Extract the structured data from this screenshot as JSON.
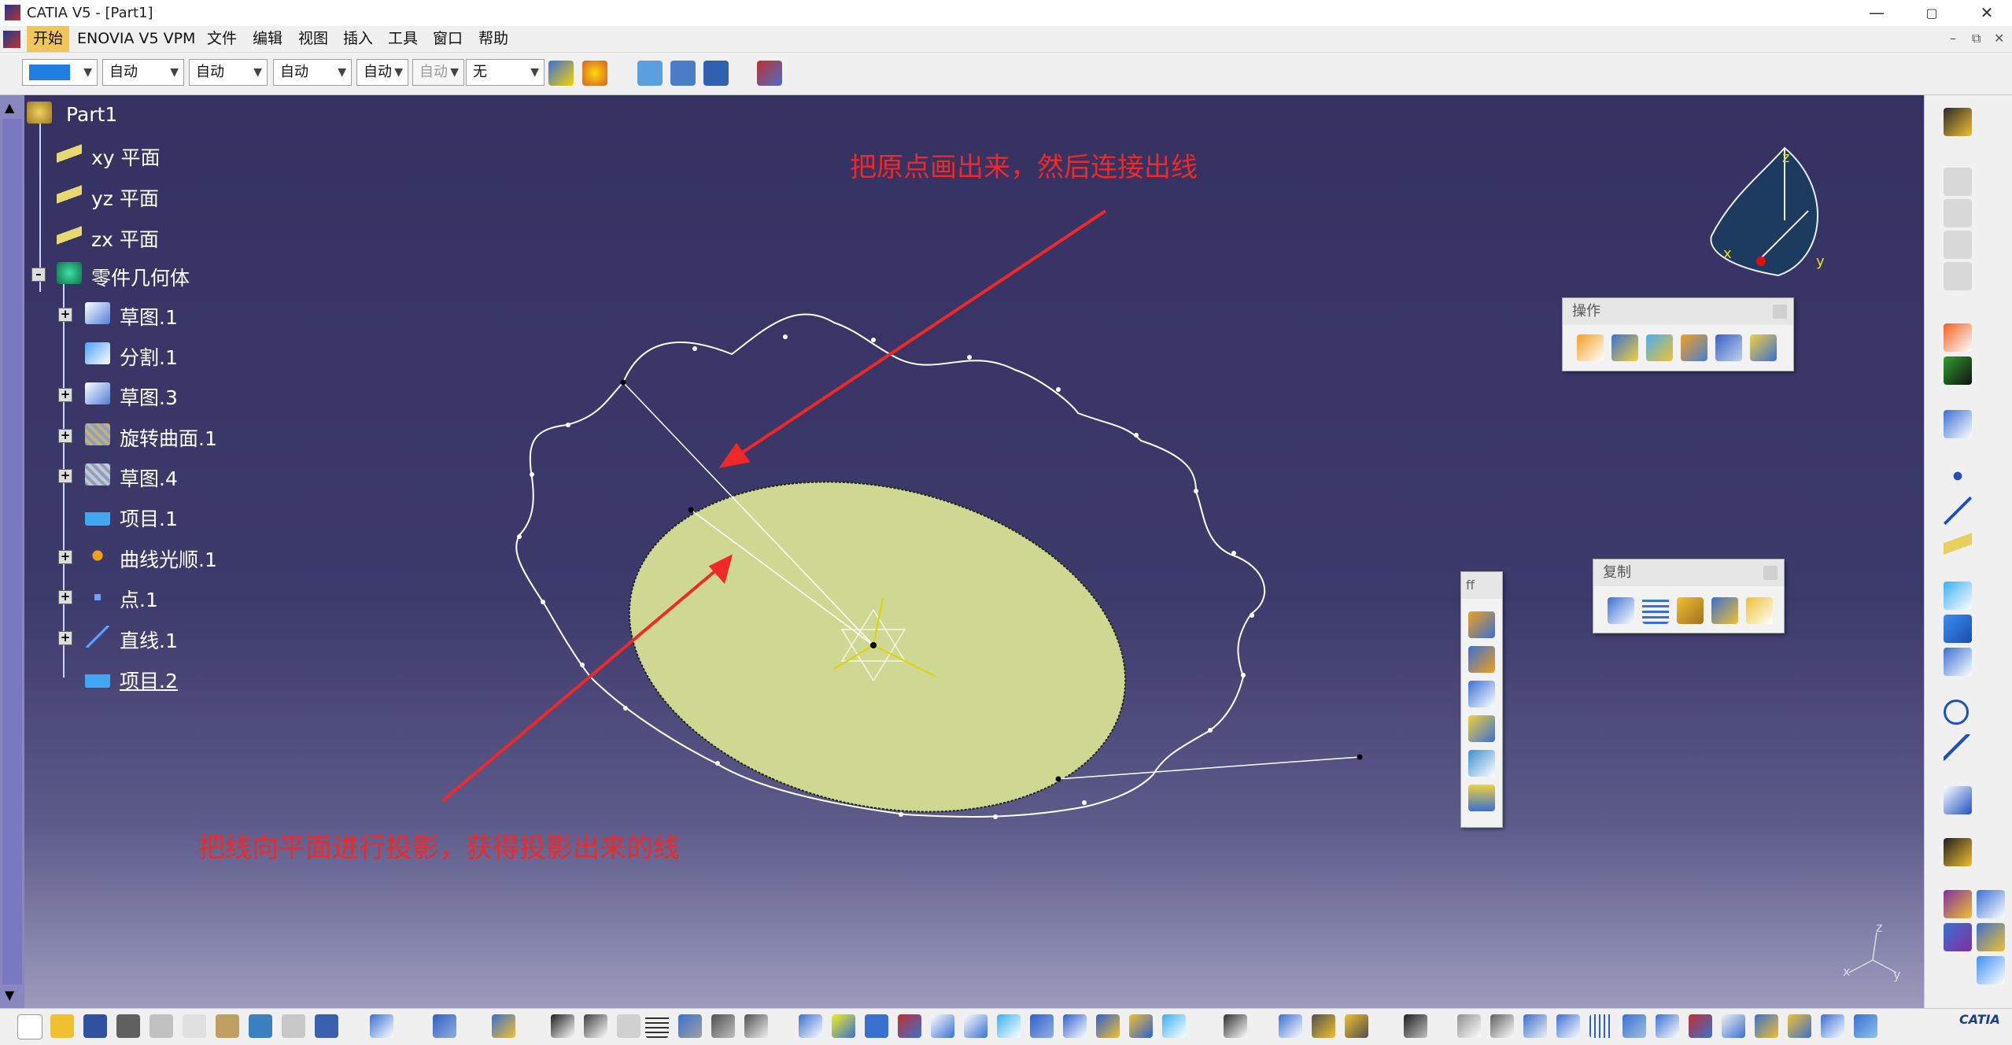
{
  "window": {
    "title": "CATIA V5 - [Part1]",
    "minimize": "—",
    "maximize": "▢",
    "close": "✕"
  },
  "menu": {
    "items": [
      "开始",
      "ENOVIA V5 VPM",
      "文件",
      "编辑",
      "视图",
      "插入",
      "工具",
      "窗口",
      "帮助"
    ]
  },
  "toolbar": {
    "combos": [
      "",
      "自动",
      "自动",
      "自动",
      "自动",
      "自动",
      "无"
    ],
    "color_swatch": "#1f7fe0"
  },
  "tree": {
    "root": "Part1",
    "items": [
      {
        "label": "xy 平面"
      },
      {
        "label": "yz 平面"
      },
      {
        "label": "zx 平面"
      },
      {
        "label": "零件几何体"
      },
      {
        "label": "草图.1"
      },
      {
        "label": "分割.1"
      },
      {
        "label": "草图.3"
      },
      {
        "label": "旋转曲面.1"
      },
      {
        "label": "草图.4"
      },
      {
        "label": "项目.1"
      },
      {
        "label": "曲线光顺.1"
      },
      {
        "label": "点.1"
      },
      {
        "label": "直线.1"
      },
      {
        "label": "项目.2"
      }
    ]
  },
  "annotations": {
    "top": "把原点画出来，然后连接出线",
    "bottom": "把线向平面进行投影，获得投影出来的线"
  },
  "palettes": {
    "operation": {
      "title": "操作"
    },
    "copy": {
      "title": "复制"
    },
    "vertical": {
      "title": "ff"
    }
  },
  "compass": {
    "x": "x",
    "y": "y",
    "z": "z"
  },
  "axis_small": {
    "x": "x",
    "y": "y",
    "z": "z"
  },
  "catia_logo": "CATIA",
  "colors": {
    "viewport_top": "#353262",
    "viewport_bottom": "#9c9bbd",
    "ellipse_fill": "#cfd892",
    "annotation": "#f02828"
  }
}
